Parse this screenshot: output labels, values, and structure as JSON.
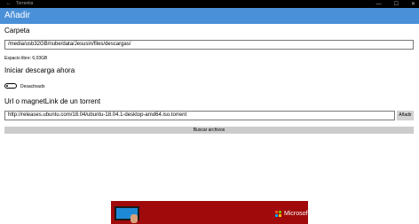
{
  "titlebar": {
    "back_icon": "←",
    "app_name": "Torrentia",
    "controls": {
      "minimize": "—",
      "maximize": "☐",
      "close": "✕"
    }
  },
  "header": {
    "title": "Añadir"
  },
  "folder": {
    "label": "Carpeta",
    "path": "/media/usb32GB/nube/data/Jesusin/files/descargas/",
    "free_space": "Espacio libre: 6,03GB"
  },
  "start_now": {
    "label": "Iniciar descarga ahora",
    "toggle_state": "Desactivado",
    "toggle_on": false
  },
  "torrent": {
    "label": "Url o magnetLink de un torrent",
    "url": "http://releases.ubuntu.com/18.04/ubuntu-18.04.1-desktop-amd64.iso.torrent",
    "add_label": "Añadir",
    "search_label": "Buscar archivos"
  },
  "ad": {
    "brand": "Microsoft",
    "background_color": "#a00a0a"
  },
  "colors": {
    "accent": "#4a90d9",
    "titlebar": "#000000"
  }
}
